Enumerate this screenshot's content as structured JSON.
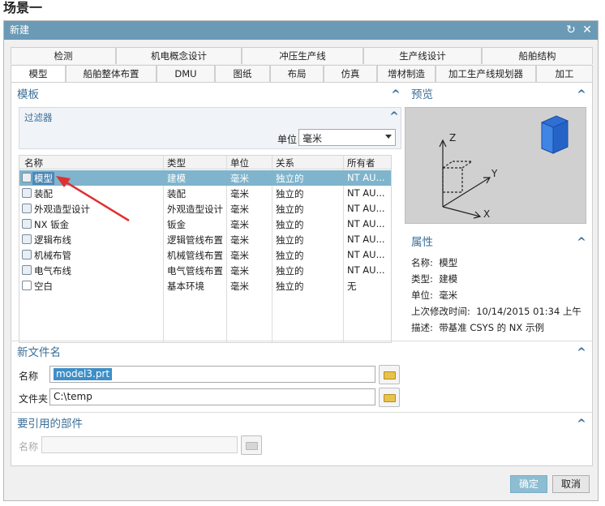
{
  "scene_title": "场景一",
  "window": {
    "title": "新建",
    "refresh_glyph": "↻",
    "close_glyph": "✕"
  },
  "tabs_top": [
    "检测",
    "机电概念设计",
    "冲压生产线",
    "生产线设计",
    "船舶结构"
  ],
  "tabs_bottom": [
    "模型",
    "船舶整体布置",
    "DMU",
    "图纸",
    "布局",
    "仿真",
    "增材制造",
    "加工生产线规划器",
    "加工"
  ],
  "templates": {
    "title": "模板",
    "filter": {
      "title": "过滤器",
      "unit_label": "单位",
      "unit_value": "毫米"
    },
    "columns": [
      "名称",
      "类型",
      "单位",
      "关系",
      "所有者"
    ],
    "rows": [
      {
        "name": "模型",
        "type": "建模",
        "unit": "毫米",
        "relation": "独立的",
        "owner": "NT AU..."
      },
      {
        "name": "装配",
        "type": "装配",
        "unit": "毫米",
        "relation": "独立的",
        "owner": "NT AU..."
      },
      {
        "name": "外观造型设计",
        "type": "外观造型设计",
        "unit": "毫米",
        "relation": "独立的",
        "owner": "NT AU..."
      },
      {
        "name": "NX 钣金",
        "type": "钣金",
        "unit": "毫米",
        "relation": "独立的",
        "owner": "NT AU..."
      },
      {
        "name": "逻辑布线",
        "type": "逻辑管线布置",
        "unit": "毫米",
        "relation": "独立的",
        "owner": "NT AU..."
      },
      {
        "name": "机械布管",
        "type": "机械管线布置",
        "unit": "毫米",
        "relation": "独立的",
        "owner": "NT AU..."
      },
      {
        "name": "电气布线",
        "type": "电气管线布置",
        "unit": "毫米",
        "relation": "独立的",
        "owner": "NT AU..."
      },
      {
        "name": "空白",
        "type": "基本环境",
        "unit": "毫米",
        "relation": "独立的",
        "owner": "无"
      }
    ]
  },
  "preview": {
    "title": "预览",
    "axis_z": "Z",
    "axis_y": "Y",
    "axis_x": "X"
  },
  "properties": {
    "title": "属性",
    "name_label": "名称:",
    "name_value": "模型",
    "type_label": "类型:",
    "type_value": "建模",
    "unit_label": "单位:",
    "unit_value": "毫米",
    "modified_label": "上次修改时间:",
    "modified_value": "10/14/2015 01:34 上午",
    "desc_label": "描述:",
    "desc_value": "带基准 CSYS 的 NX 示例"
  },
  "new_file": {
    "title": "新文件名",
    "name_label": "名称",
    "name_value": "model3.prt",
    "folder_label": "文件夹",
    "folder_value": "C:\\temp"
  },
  "referenced": {
    "title": "要引用的部件",
    "name_label": "名称"
  },
  "buttons": {
    "ok": "确定",
    "cancel": "取消"
  },
  "colors": {
    "titlebar": "#6a9ab5",
    "accent": "#3d6f97",
    "selection": "#7fb4cc",
    "ok_button": "#8dbdd3",
    "annotation_arrow": "#e03030"
  }
}
